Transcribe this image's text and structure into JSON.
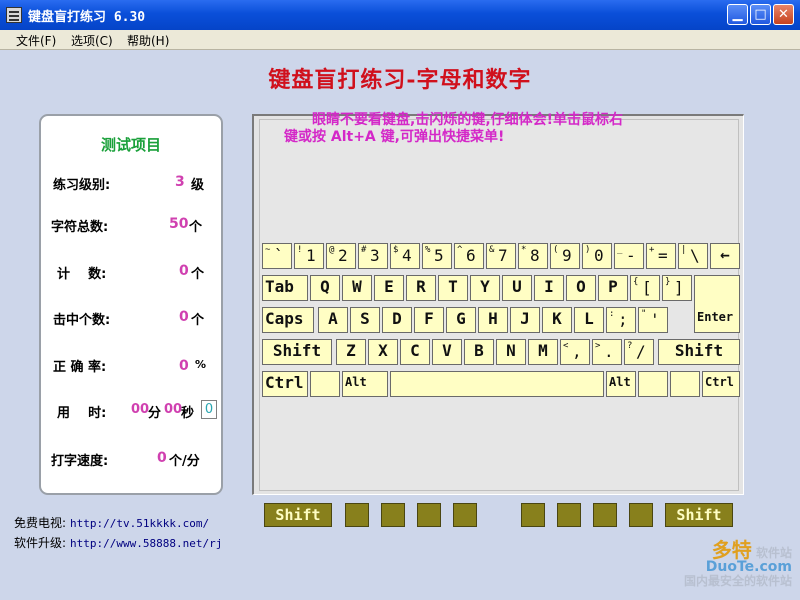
{
  "window": {
    "title": "键盘盲打练习  6.30"
  },
  "menu": [
    {
      "label": "文件(F)"
    },
    {
      "label": "选项(C)"
    },
    {
      "label": "帮助(H)"
    }
  ],
  "main_title": "键盘盲打练习-字母和数字",
  "stats": {
    "title": "测试项目",
    "level_label": "练习级别:",
    "level_value": "3",
    "level_unit": "级",
    "total_label": "字符总数:",
    "total_value": "50",
    "total_unit": "个",
    "count_label": "计    数:",
    "count_value": "0",
    "count_unit": "个",
    "hits_label": "击中个数:",
    "hits_value": "0",
    "hits_unit": "个",
    "accuracy_label": "正 确 率:",
    "accuracy_value": "0",
    "accuracy_unit": "%",
    "time_label": "用    时:",
    "time_min": "00",
    "time_min_unit": "分",
    "time_sec": "00",
    "time_sec_unit": "秒",
    "time_box": "0",
    "speed_label": "打字速度:",
    "speed_value": "0",
    "speed_unit": "个/分"
  },
  "instruction": {
    "line1": "眼睛不要看键盘,击闪烁的键,仔细体会!单击鼠标右",
    "line2": "键或按 Alt+A 键,可弹出快捷菜单!"
  },
  "keyboard": {
    "row1": [
      {
        "top": "~",
        "bottom": "`"
      },
      {
        "top": "!",
        "bottom": "1"
      },
      {
        "top": "@",
        "bottom": "2"
      },
      {
        "top": "#",
        "bottom": "3"
      },
      {
        "top": "$",
        "bottom": "4"
      },
      {
        "top": "%",
        "bottom": "5"
      },
      {
        "top": "^",
        "bottom": "6"
      },
      {
        "top": "&",
        "bottom": "7"
      },
      {
        "top": "*",
        "bottom": "8"
      },
      {
        "top": "(",
        "bottom": "9"
      },
      {
        "top": ")",
        "bottom": "0"
      },
      {
        "top": "_",
        "bottom": "-"
      },
      {
        "top": "+",
        "bottom": "="
      },
      {
        "top": "|",
        "bottom": "\\"
      },
      {
        "top": "",
        "bottom": "←"
      }
    ],
    "row2": [
      "Tab",
      "Q",
      "W",
      "E",
      "R",
      "T",
      "Y",
      "U",
      "I",
      "O",
      "P",
      "{[",
      "}]",
      "Enter"
    ],
    "row2_brackets": [
      {
        "top": "{",
        "bottom": "["
      },
      {
        "top": "}",
        "bottom": "]"
      }
    ],
    "row3": [
      "Caps",
      "A",
      "S",
      "D",
      "F",
      "G",
      "H",
      "J",
      "K",
      "L"
    ],
    "row3_sym": [
      {
        "top": ":",
        "bottom": ";"
      },
      {
        "top": "\"",
        "bottom": "'"
      }
    ],
    "row4": [
      "Shift",
      "Z",
      "X",
      "C",
      "V",
      "B",
      "N",
      "M",
      "Shift"
    ],
    "row4_sym": [
      {
        "top": "<",
        "bottom": ","
      },
      {
        "top": ">",
        "bottom": "."
      },
      {
        "top": "?",
        "bottom": "/"
      }
    ],
    "row5": {
      "ctrl_left": "Ctrl",
      "alt_left": "Alt",
      "alt_right": "Alt",
      "ctrl_right": "Ctrl"
    }
  },
  "bottom_keys": {
    "shift_left": "Shift",
    "shift_right": "Shift"
  },
  "footer": {
    "tv_label": "免费电视:",
    "tv_url": "http://tv.51kkkk.com/",
    "upgrade_label": "软件升级:",
    "upgrade_url": "http://www.58888.net/rj"
  },
  "watermark": {
    "brand": "多特",
    "brand_sub": "软件站",
    "site": "DuoTe.com",
    "slogan": "国内最安全的软件站"
  },
  "colors": {
    "title_red": "#d0101c",
    "value_magenta": "#d040b0",
    "key_fill": "#fffec4",
    "bottom_key": "#88801c"
  }
}
